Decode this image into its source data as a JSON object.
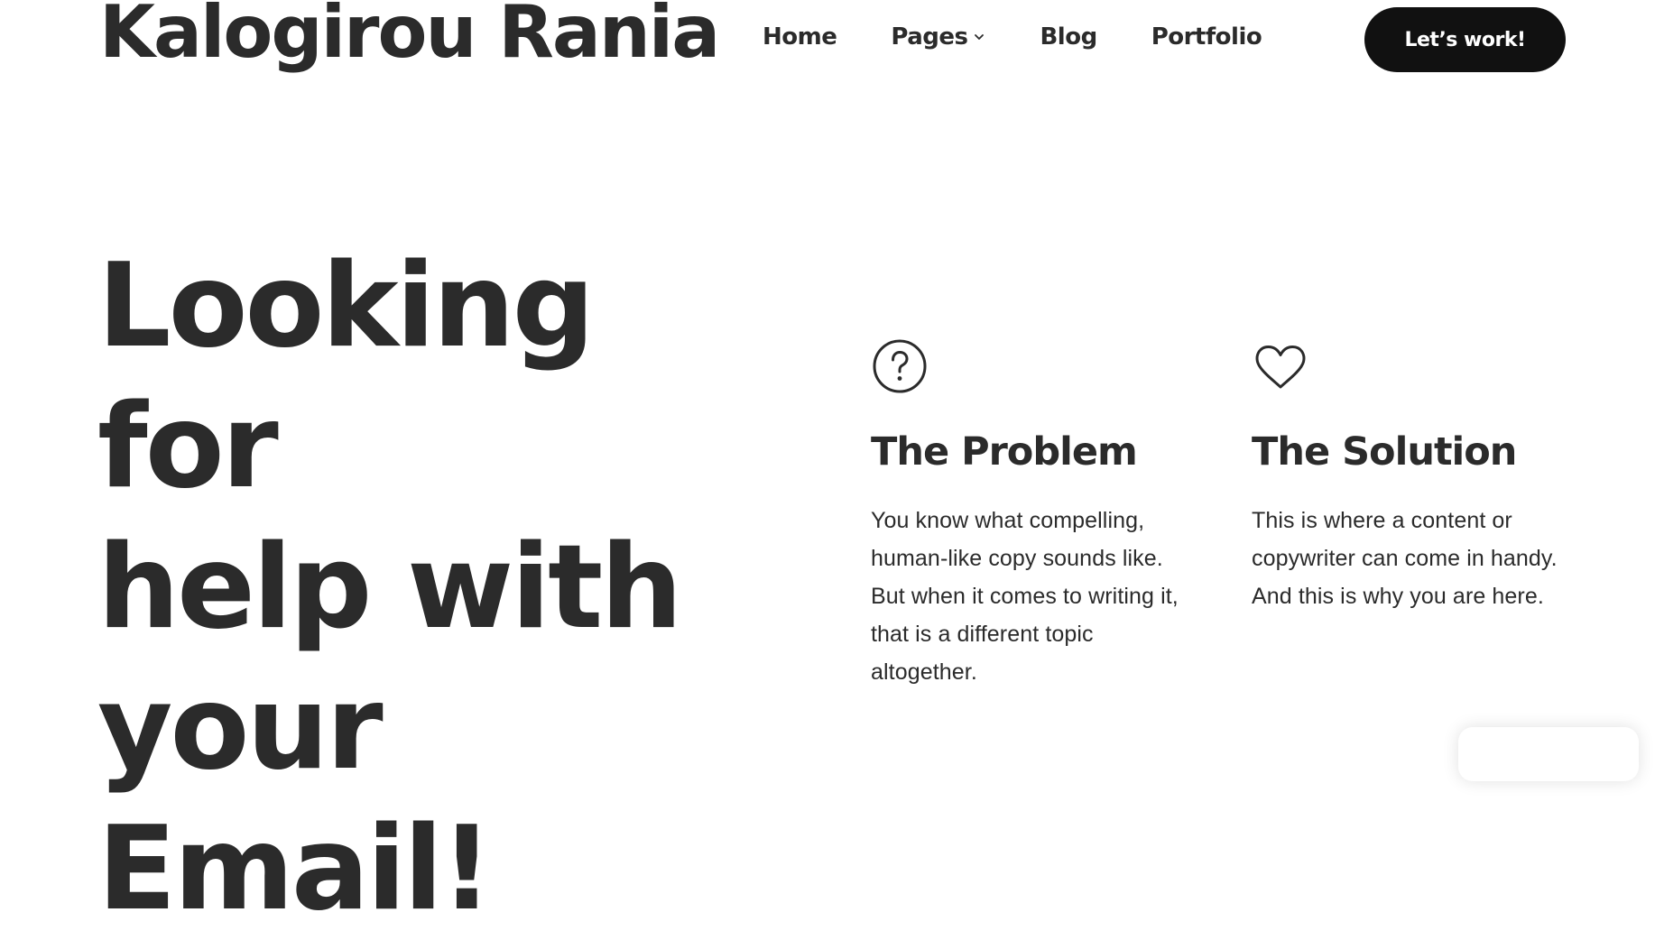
{
  "header": {
    "brand": "Kalogirou Rania",
    "nav": [
      {
        "label": "Home"
      },
      {
        "label": "Pages",
        "icon": "chevron-down-icon"
      },
      {
        "label": "Blog"
      },
      {
        "label": "Portfolio"
      }
    ],
    "cta_label": "Let’s work!"
  },
  "hero": {
    "line1": "Looking for",
    "line2": "help with",
    "line3": "your",
    "line4": "Email!"
  },
  "features": {
    "problem": {
      "icon": "question-circle-icon",
      "title": "The Problem",
      "text": "You know what compelling, human-like copy sounds like. But when it comes to writing it, that is a different topic altogether."
    },
    "solution": {
      "icon": "heart-icon",
      "title": "The Solution",
      "text": "This is where a content or copywriter can come in handy. And this is why you are here."
    }
  },
  "colors": {
    "text": "#2b2b2b",
    "button_bg": "#111111",
    "button_text": "#ffffff",
    "background": "#ffffff"
  }
}
